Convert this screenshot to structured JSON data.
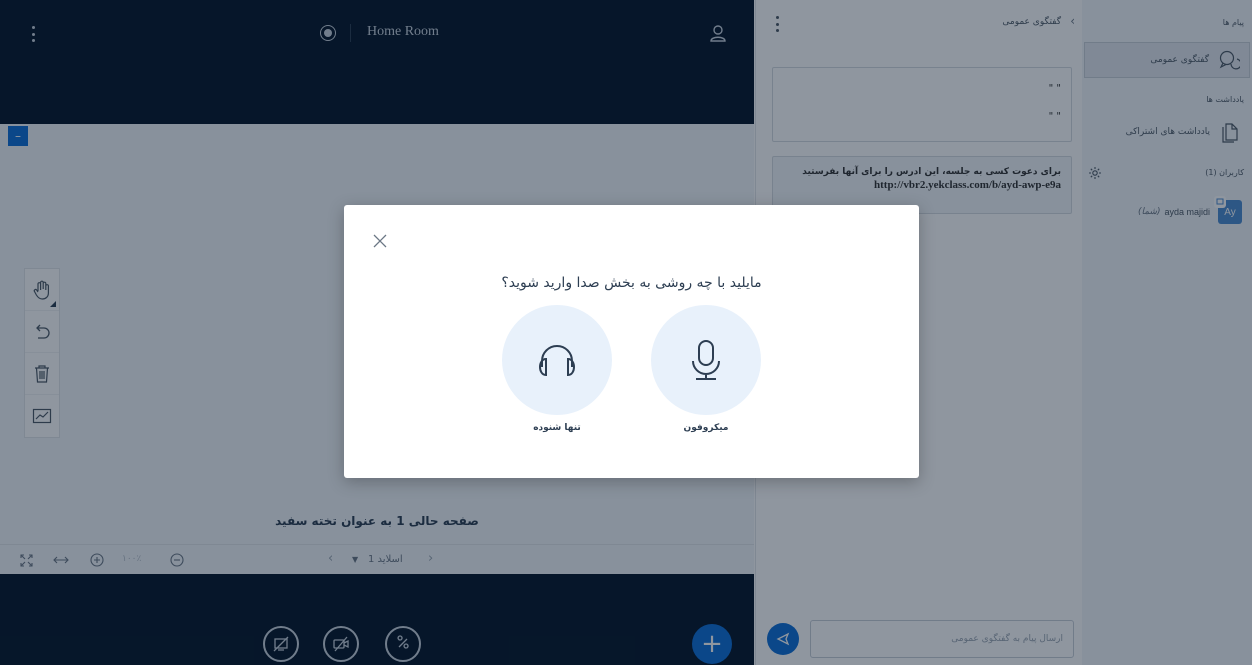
{
  "room": {
    "title": "Home Room"
  },
  "userlist": {
    "messages_heading": "پیام ها",
    "public_chat_label": "گفتگوی عمومی",
    "notes_heading": "یادداشت ها",
    "shared_notes_label": "یادداشت های اشتراکی",
    "users_heading": "کاربران (1)",
    "user": {
      "initials": "Ay",
      "name": "ayda majidi",
      "you_tag": "(شما)"
    }
  },
  "chat": {
    "title": "گفتگوی عمومی",
    "message1_line1": "\" \"",
    "message1_line2": "\" \"",
    "invite_text": "برای دعوت کسی به جلسه، این ادرس را برای آنها بفرستید",
    "invite_link": "http://vbr2.yekclass.com/b/ayd-awp-e9a",
    "input_placeholder": "ارسال پیام به گفتگوی عمومی"
  },
  "whiteboard": {
    "caption": "صفحه حالی 1 به عنوان تخته سفید",
    "zoom_value": "۱۰۰٪",
    "slide_label": "اسلاید 1"
  },
  "modal": {
    "question": "مایلید با چه روشی به بخش صدا وارید شوید؟",
    "microphone_label": "میکروفون",
    "listen_only_label": "تنها شنوده"
  },
  "colors": {
    "primary": "#0f70d7",
    "dark_bg": "#06172a",
    "panel_bg": "#f3f6f9"
  }
}
